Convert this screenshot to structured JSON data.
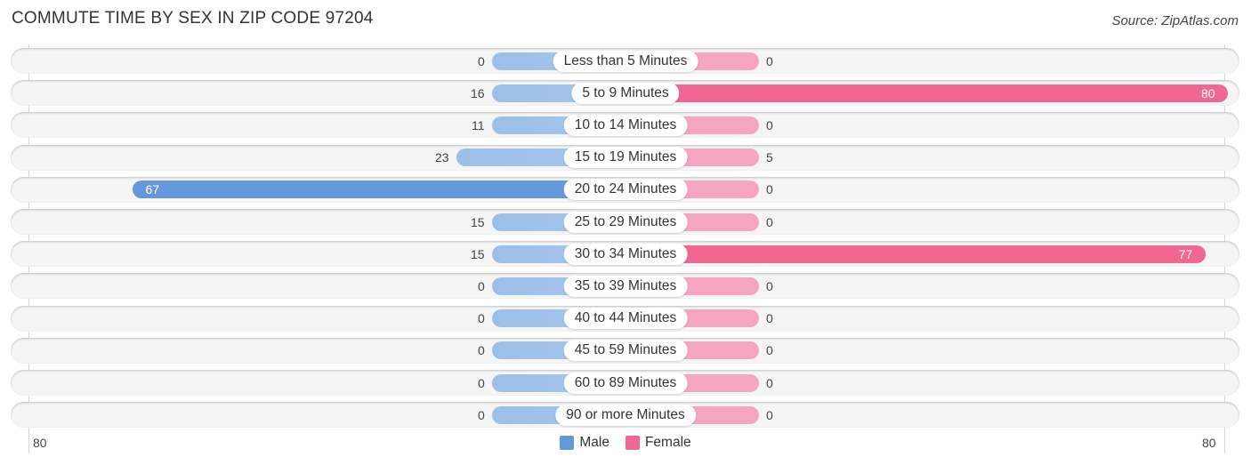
{
  "header": {
    "title": "COMMUTE TIME BY SEX IN ZIP CODE 97204",
    "source": "Source: ZipAtlas.com"
  },
  "colors": {
    "male_light": "#a9c8ec",
    "male_strong": "#6398da",
    "female_light": "#f5a5bf",
    "female_strong": "#f06792"
  },
  "chart_data": {
    "type": "bar",
    "orientation": "horizontal-diverging",
    "title": "COMMUTE TIME BY SEX IN ZIP CODE 97204",
    "categories": [
      "Less than 5 Minutes",
      "5 to 9 Minutes",
      "10 to 14 Minutes",
      "15 to 19 Minutes",
      "20 to 24 Minutes",
      "25 to 29 Minutes",
      "30 to 34 Minutes",
      "35 to 39 Minutes",
      "40 to 44 Minutes",
      "45 to 59 Minutes",
      "60 to 89 Minutes",
      "90 or more Minutes"
    ],
    "series": [
      {
        "name": "Male",
        "values": [
          0,
          16,
          11,
          23,
          67,
          15,
          15,
          0,
          0,
          0,
          0,
          0
        ]
      },
      {
        "name": "Female",
        "values": [
          0,
          80,
          0,
          5,
          0,
          0,
          77,
          0,
          0,
          0,
          0,
          0
        ]
      }
    ],
    "axis": {
      "left_tick": "80",
      "right_tick": "80",
      "range": [
        -80,
        80
      ]
    },
    "legend": {
      "position": "bottom-center",
      "items": [
        "Male",
        "Female"
      ]
    }
  }
}
